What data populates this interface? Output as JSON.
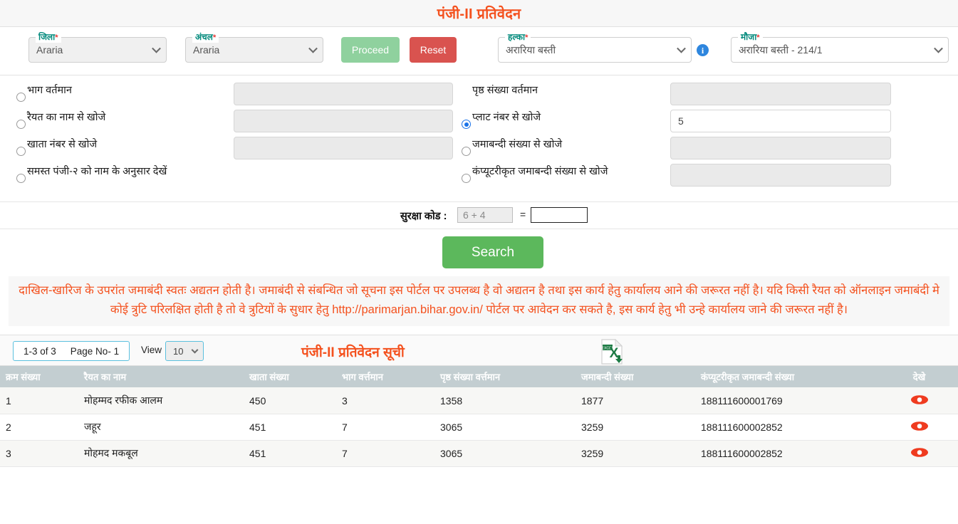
{
  "header": {
    "title": "पंजी-II प्रतिवेदन"
  },
  "filters": {
    "district": {
      "label": "जिला",
      "required": "*",
      "value": "Araria"
    },
    "circle": {
      "label": "अंचल",
      "required": "*",
      "value": "Araria"
    },
    "halka": {
      "label": "हल्का",
      "required": "*",
      "value": "अरारिया बस्ती"
    },
    "mauja": {
      "label": "मौजा",
      "required": "*",
      "value": "अरारिया बस्ती - 214/1"
    },
    "proceed_label": "Proceed",
    "reset_label": "Reset",
    "info_icon": "info-icon",
    "info_glyph": "i"
  },
  "criteria": {
    "left": [
      {
        "label": "भाग वर्तमान",
        "selected": false,
        "value": ""
      },
      {
        "label": "रैयत का नाम से खोजे",
        "selected": false,
        "value": ""
      },
      {
        "label": "खाता नंबर से खोजे",
        "selected": false,
        "value": ""
      },
      {
        "label": "समस्त पंजी-२ को नाम के अनुसार देखें",
        "selected": false,
        "value": null
      }
    ],
    "right": [
      {
        "label": "पृष्ठ संख्या वर्तमान",
        "selected": false,
        "value": "",
        "has_radio": false
      },
      {
        "label": "प्लाट नंबर से खोजे",
        "selected": true,
        "value": "5",
        "has_radio": true
      },
      {
        "label": "जमाबन्दी संख्या से खोजे",
        "selected": false,
        "value": "",
        "has_radio": true
      },
      {
        "label": "कंप्यूटरीकृत जमाबन्दी संख्या से खोजे",
        "selected": false,
        "value": "",
        "has_radio": true
      }
    ]
  },
  "captcha": {
    "label": "सुरक्षा कोड :",
    "question": "6 + 4",
    "equals": "=",
    "answer": ""
  },
  "search": {
    "label": "Search"
  },
  "notice": {
    "text": "दाखिल-खारिज के उपरांत जमाबंदी स्वतः अद्यतन होती है। जमाबंदी से संबन्धित जो सूचना इस पोर्टल पर उपलब्ध है वो अद्यतन है तथा इस कार्य हेतु कार्यालय आने की जरूरत नहीं है। यदि किसी रैयत को ऑनलाइन जमाबंदी मे कोई त्रुटि परिलक्षित होती है तो वे त्रुटियों के सुधार हेतु http://parimarjan.bihar.gov.in/ पोर्टल पर आवेदन कर सकते है, इस कार्य हेतु भी उन्हे कार्यालय जाने की जरूरत नहीं है।",
    "color": "#f4511e"
  },
  "list_toolbar": {
    "range": "1-3 of 3",
    "page_no": "Page No- 1",
    "view_label": "View",
    "view_value": "10",
    "title": "पंजी-II प्रतिवेदन सूची",
    "excel_icon": "excel-export-icon",
    "excel_badge": "EXCEL",
    "excel_glyph": "X"
  },
  "table": {
    "columns": [
      "क्रम संख्या",
      "रैयत का नाम",
      "खाता संख्या",
      "भाग वर्त्तमान",
      "पृष्ठ संख्या वर्त्तमान",
      "जमाबन्दी संख्या",
      "कंप्यूटरीकृत जमाबन्दी संख्या",
      "देखे"
    ],
    "rows": [
      {
        "sl": "1",
        "name": "मोहम्मद रफीक आलम",
        "khata": "450",
        "bhag": "3",
        "prishth": "1358",
        "jamabandi": "1877",
        "comp_jamabandi": "188111600001769",
        "view_icon": "eye-icon",
        "link": false
      },
      {
        "sl": "2",
        "name": "जहूर",
        "khata": "451",
        "bhag": "7",
        "prishth": "3065",
        "jamabandi": "3259",
        "comp_jamabandi": "188111600002852",
        "view_icon": "eye-icon",
        "link": true
      },
      {
        "sl": "3",
        "name": "मोहमद मकबूल",
        "khata": "451",
        "bhag": "7",
        "prishth": "3065",
        "jamabandi": "3259",
        "comp_jamabandi": "188111600002852",
        "view_icon": "eye-icon",
        "link": false
      }
    ]
  },
  "colors": {
    "accent_orange": "#f4511e",
    "label_teal": "#00897b",
    "required_red": "#e53935",
    "proceed_green": "#8fd19e",
    "reset_red": "#d9534f",
    "search_green": "#5cb85c",
    "table_header": "#c3ced1",
    "radio_blue": "#1a73e8",
    "eye_red": "#ef3b1f",
    "link_blue": "#2a5db0"
  }
}
